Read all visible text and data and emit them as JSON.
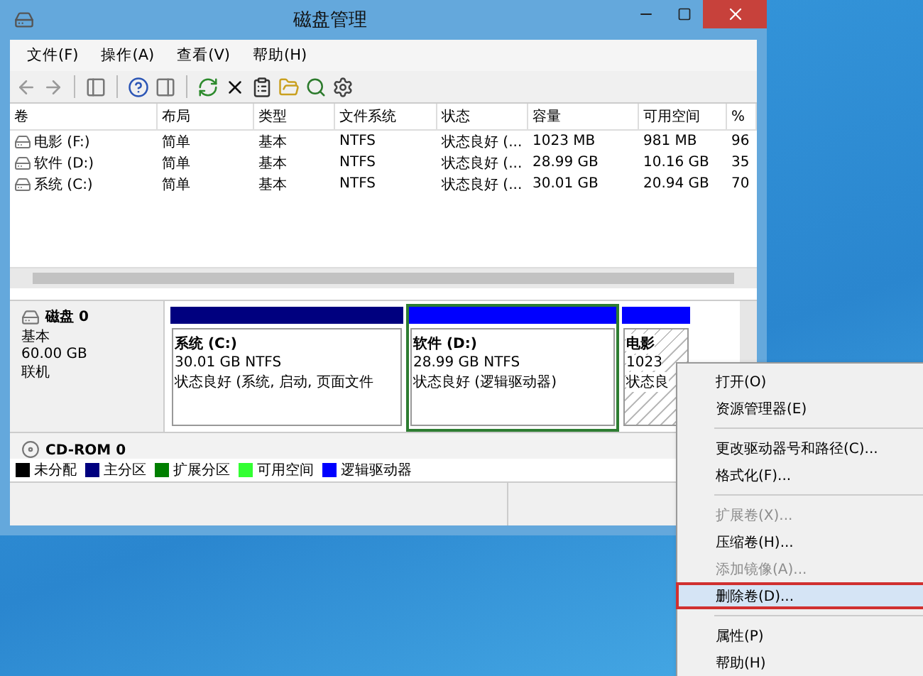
{
  "window": {
    "title": "磁盘管理"
  },
  "menu": [
    {
      "label": "文件(F)"
    },
    {
      "label": "操作(A)"
    },
    {
      "label": "查看(V)"
    },
    {
      "label": "帮助(H)"
    }
  ],
  "table": {
    "columns": [
      "卷",
      "布局",
      "类型",
      "文件系统",
      "状态",
      "容量",
      "可用空间",
      "%"
    ],
    "rows": [
      [
        "电影 (F:)",
        "简单",
        "基本",
        "NTFS",
        "状态良好 (...",
        "1023 MB",
        "981 MB",
        "96"
      ],
      [
        "软件 (D:)",
        "简单",
        "基本",
        "NTFS",
        "状态良好 (...",
        "28.99 GB",
        "10.16 GB",
        "35"
      ],
      [
        "系统 (C:)",
        "简单",
        "基本",
        "NTFS",
        "状态良好 (...",
        "30.01 GB",
        "20.94 GB",
        "70"
      ]
    ]
  },
  "disks": [
    {
      "name": "磁盘 0",
      "type": "基本",
      "size": "60.00 GB",
      "status": "联机",
      "partitions": [
        {
          "kind": "primary",
          "title": "系统  (C:)",
          "size": "30.01 GB NTFS",
          "status": "状态良好 (系统, 启动, 页面文件",
          "selected": false,
          "hatched": false
        },
        {
          "kind": "logical",
          "title": "软件  (D:)",
          "size": "28.99 GB NTFS",
          "status": "状态良好 (逻辑驱动器)",
          "selected": true,
          "hatched": false
        },
        {
          "kind": "logical",
          "title": "电影",
          "size": "1023",
          "status": "状态良",
          "selected": false,
          "hatched": true
        }
      ]
    }
  ],
  "cdrom": {
    "name": "CD-ROM 0"
  },
  "legend": [
    {
      "label": "未分配",
      "color": "#000000"
    },
    {
      "label": "主分区",
      "color": "#00007f"
    },
    {
      "label": "扩展分区",
      "color": "#007f00"
    },
    {
      "label": "可用空间",
      "color": "#33ff33"
    },
    {
      "label": "逻辑驱动器",
      "color": "#0000ff"
    }
  ],
  "context_menu": [
    {
      "kind": "item",
      "label": "打开(O)",
      "disabled": false,
      "selected": false
    },
    {
      "kind": "item",
      "label": "资源管理器(E)",
      "disabled": false,
      "selected": false
    },
    {
      "kind": "separator"
    },
    {
      "kind": "item",
      "label": "更改驱动器号和路径(C)...",
      "disabled": false,
      "selected": false
    },
    {
      "kind": "item",
      "label": "格式化(F)...",
      "disabled": false,
      "selected": false
    },
    {
      "kind": "separator"
    },
    {
      "kind": "item",
      "label": "扩展卷(X)...",
      "disabled": true,
      "selected": false
    },
    {
      "kind": "item",
      "label": "压缩卷(H)...",
      "disabled": false,
      "selected": false
    },
    {
      "kind": "item",
      "label": "添加镜像(A)...",
      "disabled": true,
      "selected": false
    },
    {
      "kind": "item",
      "label": "删除卷(D)...",
      "disabled": false,
      "selected": true
    },
    {
      "kind": "separator"
    },
    {
      "kind": "item",
      "label": "属性(P)",
      "disabled": false,
      "selected": false
    },
    {
      "kind": "item",
      "label": "帮助(H)",
      "disabled": false,
      "selected": false
    }
  ]
}
